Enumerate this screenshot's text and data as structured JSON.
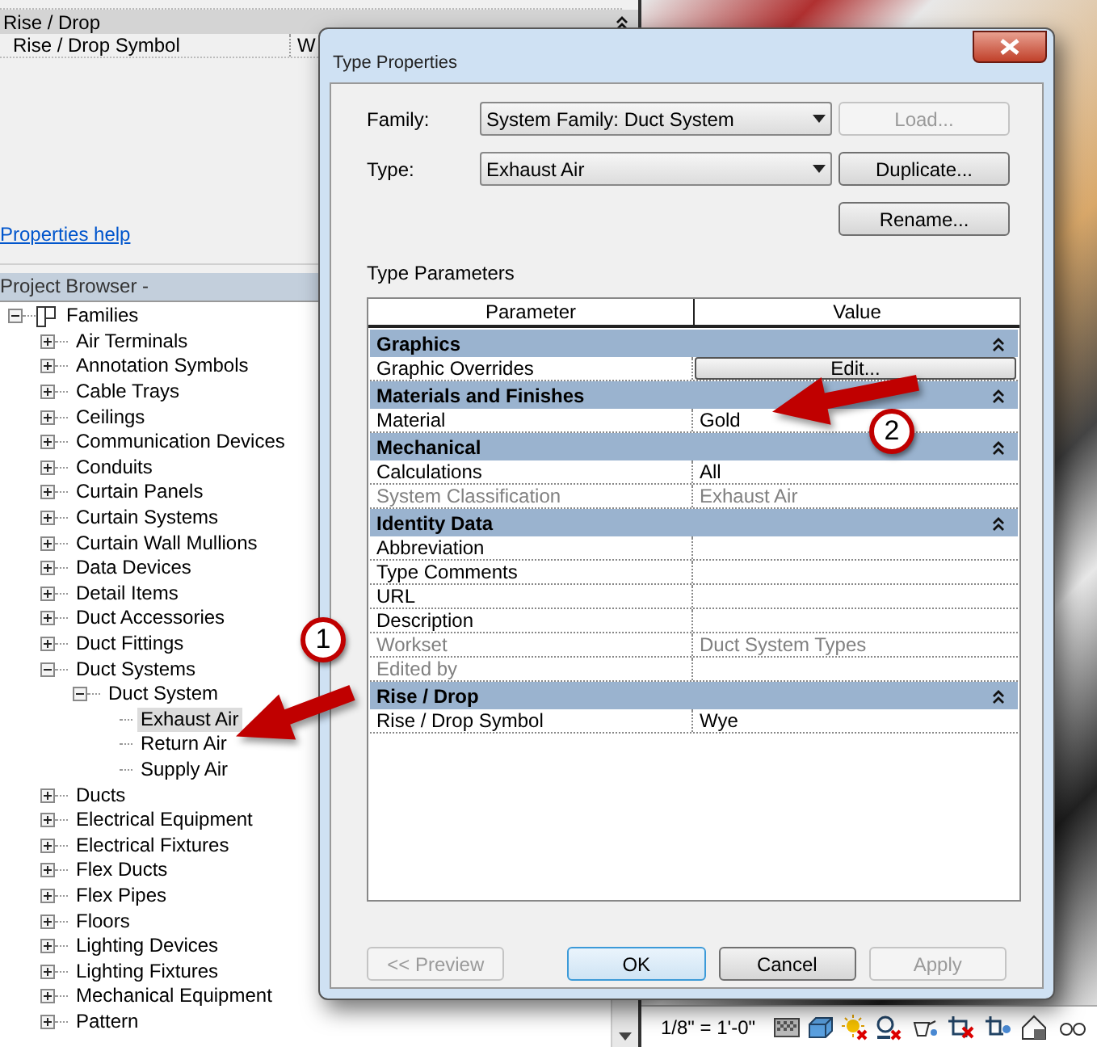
{
  "properties_panel": {
    "rows": [
      {
        "kind": "group",
        "label": "Rise / Drop"
      },
      {
        "kind": "row",
        "label": "Rise / Drop Symbol",
        "value": "W"
      }
    ],
    "help_link": "Properties help"
  },
  "project_browser": {
    "title": "Project Browser -",
    "tree": [
      {
        "label": "Families",
        "expanded": true,
        "selected": false,
        "children": [
          {
            "label": "Air Terminals",
            "expanded": false,
            "selected": false
          },
          {
            "label": "Annotation Symbols",
            "expanded": false,
            "selected": false
          },
          {
            "label": "Cable Trays",
            "expanded": false,
            "selected": false
          },
          {
            "label": "Ceilings",
            "expanded": false,
            "selected": false
          },
          {
            "label": "Communication Devices",
            "expanded": false,
            "selected": false
          },
          {
            "label": "Conduits",
            "expanded": false,
            "selected": false
          },
          {
            "label": "Curtain Panels",
            "expanded": false,
            "selected": false
          },
          {
            "label": "Curtain Systems",
            "expanded": false,
            "selected": false
          },
          {
            "label": "Curtain Wall Mullions",
            "expanded": false,
            "selected": false
          },
          {
            "label": "Data Devices",
            "expanded": false,
            "selected": false
          },
          {
            "label": "Detail Items",
            "expanded": false,
            "selected": false
          },
          {
            "label": "Duct Accessories",
            "expanded": false,
            "selected": false
          },
          {
            "label": "Duct Fittings",
            "expanded": false,
            "selected": false
          },
          {
            "label": "Duct Systems",
            "expanded": true,
            "selected": false,
            "children": [
              {
                "label": "Duct System",
                "expanded": true,
                "selected": false,
                "children": [
                  {
                    "label": "Exhaust Air",
                    "selected": true
                  },
                  {
                    "label": "Return Air",
                    "selected": false
                  },
                  {
                    "label": "Supply Air",
                    "selected": false
                  }
                ]
              }
            ]
          },
          {
            "label": "Ducts",
            "expanded": false,
            "selected": false
          },
          {
            "label": "Electrical Equipment",
            "expanded": false,
            "selected": false
          },
          {
            "label": "Electrical Fixtures",
            "expanded": false,
            "selected": false
          },
          {
            "label": "Flex Ducts",
            "expanded": false,
            "selected": false
          },
          {
            "label": "Flex Pipes",
            "expanded": false,
            "selected": false
          },
          {
            "label": "Floors",
            "expanded": false,
            "selected": false
          },
          {
            "label": "Lighting Devices",
            "expanded": false,
            "selected": false
          },
          {
            "label": "Lighting Fixtures",
            "expanded": false,
            "selected": false
          },
          {
            "label": "Mechanical Equipment",
            "expanded": false,
            "selected": false
          },
          {
            "label": "Pattern",
            "expanded": false,
            "selected": false
          }
        ]
      }
    ]
  },
  "dialog": {
    "title": "Type Properties",
    "family": {
      "label": "Family:",
      "value": "System Family: Duct System"
    },
    "type": {
      "label": "Type:",
      "value": "Exhaust Air"
    },
    "side_buttons": [
      {
        "label": "Load...",
        "disabled": true
      },
      {
        "label": "Duplicate...",
        "disabled": false
      },
      {
        "label": "Rename...",
        "disabled": false
      }
    ],
    "section_label": "Type Parameters",
    "columns": [
      "Parameter",
      "Value"
    ],
    "groups": [
      {
        "name": "Graphics",
        "rows": [
          {
            "parameter": "Graphic Overrides",
            "value": "Edit...",
            "kind": "button",
            "disabled": false
          }
        ]
      },
      {
        "name": "Materials and Finishes",
        "rows": [
          {
            "parameter": "Material",
            "value": "Gold",
            "kind": "text",
            "disabled": false
          }
        ]
      },
      {
        "name": "Mechanical",
        "rows": [
          {
            "parameter": "Calculations",
            "value": "All",
            "kind": "text",
            "disabled": false
          },
          {
            "parameter": "System Classification",
            "value": "Exhaust Air",
            "kind": "text",
            "disabled": true
          }
        ]
      },
      {
        "name": "Identity Data",
        "rows": [
          {
            "parameter": "Abbreviation",
            "value": "",
            "kind": "text",
            "disabled": false
          },
          {
            "parameter": "Type Comments",
            "value": "",
            "kind": "text",
            "disabled": false
          },
          {
            "parameter": "URL",
            "value": "",
            "kind": "text",
            "disabled": false
          },
          {
            "parameter": "Description",
            "value": "",
            "kind": "text",
            "disabled": false
          },
          {
            "parameter": "Workset",
            "value": "Duct System Types",
            "kind": "text",
            "disabled": true
          },
          {
            "parameter": "Edited by",
            "value": "",
            "kind": "text",
            "disabled": true
          }
        ]
      },
      {
        "name": "Rise / Drop",
        "rows": [
          {
            "parameter": "Rise / Drop Symbol",
            "value": "Wye",
            "kind": "text",
            "disabled": false
          }
        ]
      }
    ],
    "bottom_buttons": [
      {
        "label": "<< Preview",
        "disabled": true,
        "default": false
      },
      {
        "label": "OK",
        "disabled": false,
        "default": true
      },
      {
        "label": "Cancel",
        "disabled": false,
        "default": false
      },
      {
        "label": "Apply",
        "disabled": true,
        "default": false
      }
    ]
  },
  "callouts": [
    {
      "number": "1"
    },
    {
      "number": "2"
    }
  ],
  "status_bar": {
    "scale": "1/8\" = 1'-0\""
  }
}
